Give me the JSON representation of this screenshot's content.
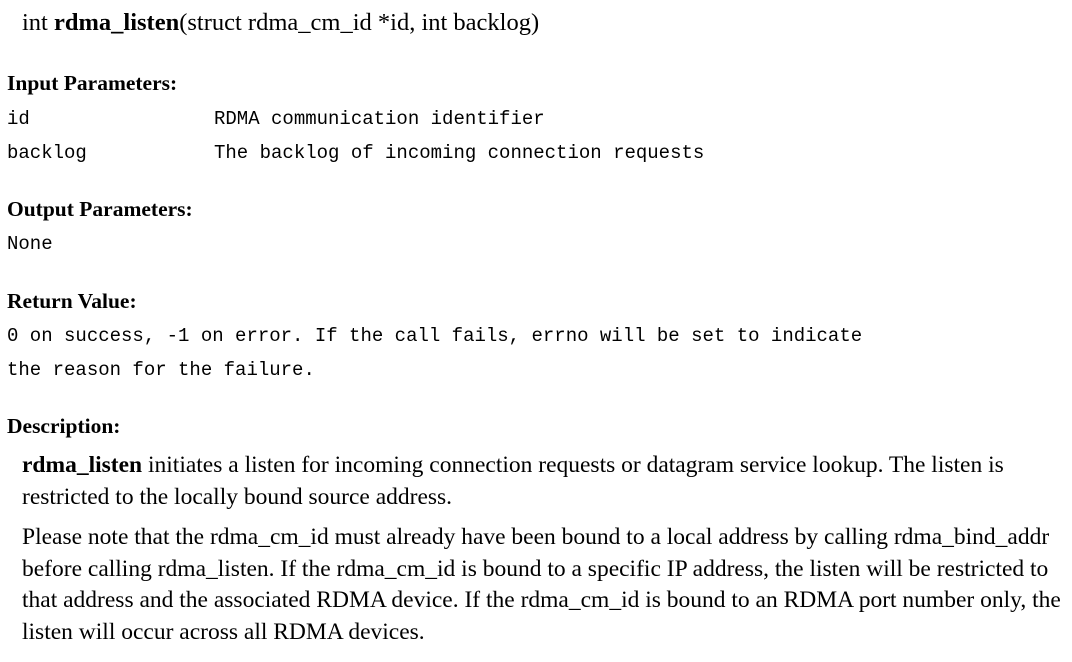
{
  "signature": {
    "return_type": "int",
    "function_name": "rdma_listen",
    "params_text": "(struct rdma_cm_id *id, int backlog)"
  },
  "input_parameters": {
    "heading": "Input Parameters:",
    "rows": [
      {
        "name": "id",
        "description": "RDMA communication identifier"
      },
      {
        "name": "backlog",
        "description": "The backlog of incoming connection requests"
      }
    ]
  },
  "output_parameters": {
    "heading": "Output Parameters:",
    "value": "None"
  },
  "return_value": {
    "heading": "Return Value:",
    "lines": [
      "0 on success, -1 on error. If the call fails, errno will be set to indicate",
      "the reason for the failure."
    ]
  },
  "description": {
    "heading": "Description:",
    "para1_bold": "rdma_listen",
    "para1_rest": " initiates a listen for incoming connection requests or datagram service lookup. The listen is restricted to the locally bound source address.",
    "para2": "Please note that the rdma_cm_id must already have been bound to a local address by calling rdma_bind_addr before calling rdma_listen. If the rdma_cm_id is bound to a specific IP address, the listen will be restricted to that address and the associated RDMA device. If the rdma_cm_id is bound to an RDMA port number only, the listen will occur across all RDMA devices."
  }
}
